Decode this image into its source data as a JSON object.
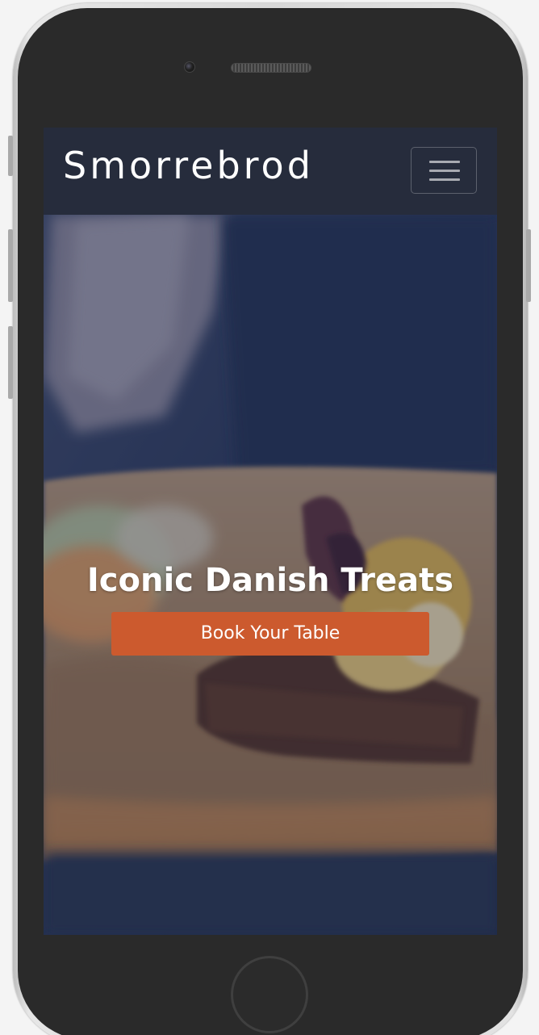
{
  "navbar": {
    "brand": "Smorrebrod",
    "menu_icon": "hamburger-menu-icon"
  },
  "hero": {
    "title": "Iconic Danish Treats",
    "cta_label": "Book Your Table"
  },
  "colors": {
    "navbar_bg": "#262c3c",
    "cta_bg": "#cc5a2e",
    "text": "#ffffff"
  }
}
